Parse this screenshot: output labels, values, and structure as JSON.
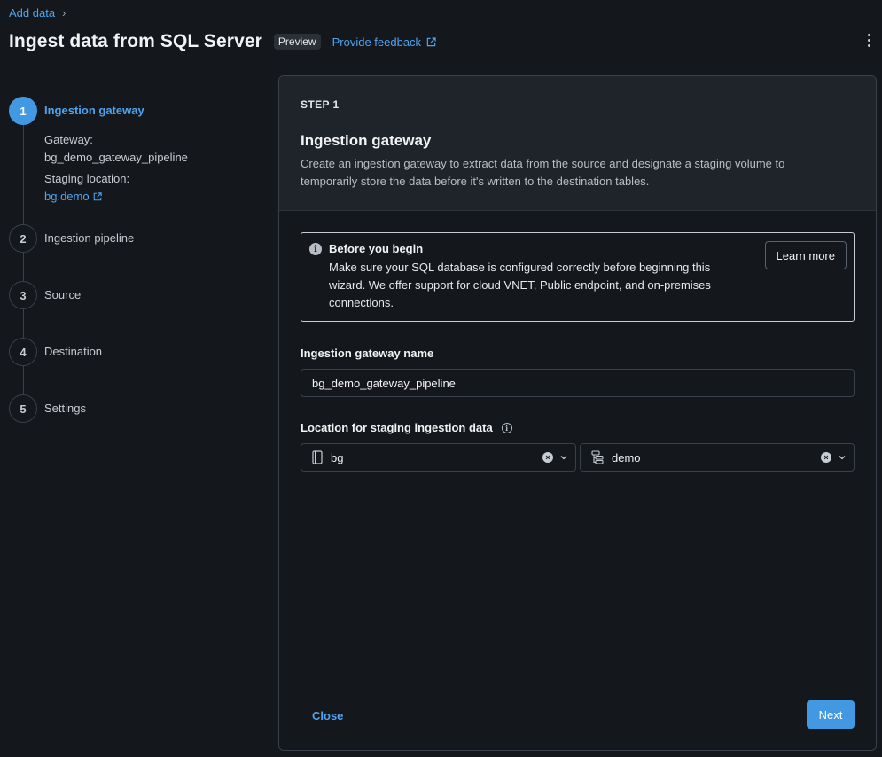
{
  "breadcrumb": {
    "parent": "Add data",
    "separator": "›"
  },
  "header": {
    "title": "Ingest data from SQL Server",
    "badge": "Preview",
    "feedback_link": "Provide feedback"
  },
  "stepper": {
    "steps": [
      {
        "number": "1",
        "label": "Ingestion gateway",
        "active": true
      },
      {
        "number": "2",
        "label": "Ingestion pipeline",
        "active": false
      },
      {
        "number": "3",
        "label": "Source",
        "active": false
      },
      {
        "number": "4",
        "label": "Destination",
        "active": false
      },
      {
        "number": "5",
        "label": "Settings",
        "active": false
      }
    ],
    "details": {
      "gateway_label": "Gateway:",
      "gateway_value": "bg_demo_gateway_pipeline",
      "staging_label": "Staging location:",
      "staging_value": "bg.demo"
    }
  },
  "card": {
    "step_label": "STEP 1",
    "title": "Ingestion gateway",
    "description": "Create an ingestion gateway to extract data from the source and designate a staging volume to temporarily store the data before it's written to the destination tables.",
    "notice": {
      "title": "Before you begin",
      "body": "Make sure your SQL database is configured correctly before beginning this wizard. We offer support for cloud VNET, Public endpoint, and on-premises connections.",
      "button": "Learn more"
    },
    "gateway_name": {
      "label": "Ingestion gateway name",
      "value": "bg_demo_gateway_pipeline"
    },
    "staging": {
      "label": "Location for staging ingestion data",
      "catalog": "bg",
      "schema": "demo"
    },
    "close_label": "Close",
    "next_label": "Next"
  },
  "colors": {
    "accent": "#4299e1",
    "link": "#4ea4f0",
    "background": "#14171b"
  }
}
